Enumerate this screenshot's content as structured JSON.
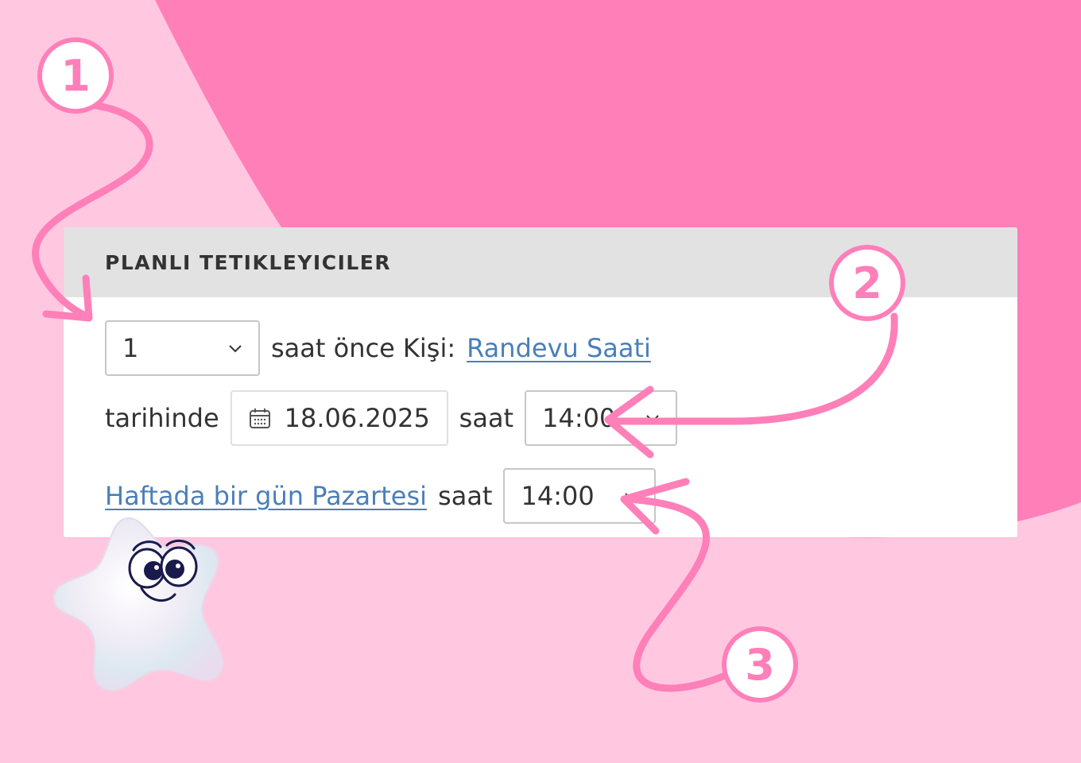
{
  "panel": {
    "title": "PLANLI TETIKLEYICILER"
  },
  "row1": {
    "count_value": "1",
    "text": "saat önce Kişi:",
    "link": "Randevu Saati"
  },
  "row2": {
    "prefix": "tarihinde",
    "date_value": "18.06.2025",
    "mid_text": "saat",
    "time_value": "14:00"
  },
  "row3": {
    "link": "Haftada bir gün Pazartesi",
    "mid_text": "saat",
    "time_value": "14:00"
  },
  "badges": {
    "one": "1",
    "two": "2",
    "three": "3"
  },
  "colors": {
    "background": "#ffc8e0",
    "blob": "#ff7fb9",
    "panel_header": "#e2e2e2",
    "link": "#4a7fb8",
    "annotation": "#ff7fb9"
  },
  "icons": [
    "calendar-icon",
    "chevron-down-icon",
    "star-mascot"
  ]
}
